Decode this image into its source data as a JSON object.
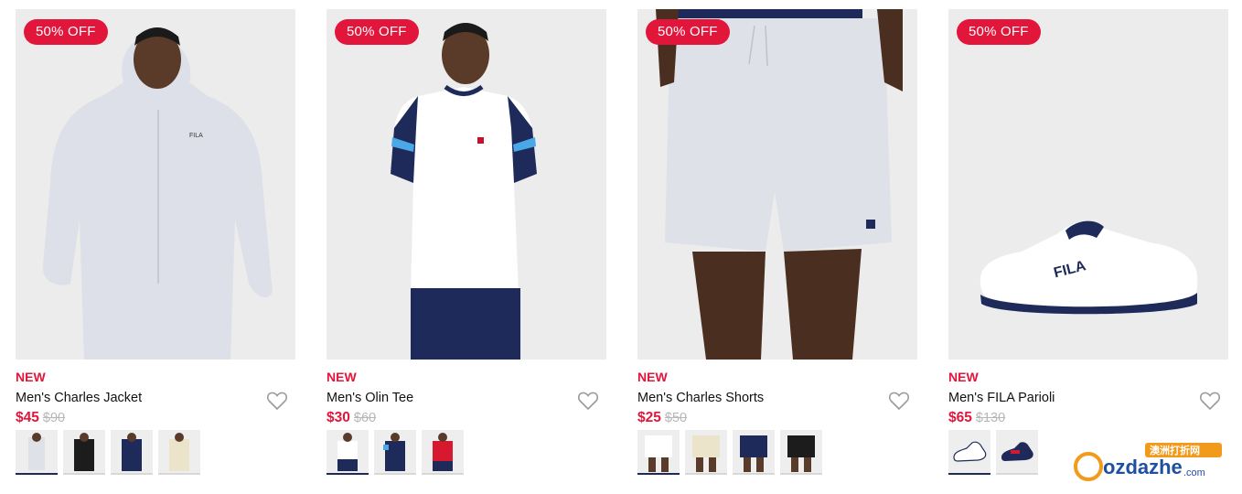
{
  "products": [
    {
      "badge": "50% OFF",
      "tag": "NEW",
      "name": "Men's Charles Jacket",
      "price_now": "$45",
      "price_was": "$90"
    },
    {
      "badge": "50% OFF",
      "tag": "NEW",
      "name": "Men's Olin Tee",
      "price_now": "$30",
      "price_was": "$60"
    },
    {
      "badge": "50% OFF",
      "tag": "NEW",
      "name": "Men's Charles Shorts",
      "price_now": "$25",
      "price_was": "$50"
    },
    {
      "badge": "50% OFF",
      "tag": "NEW",
      "name": "Men's FILA Parioli",
      "price_now": "$65",
      "price_was": "$130"
    }
  ],
  "watermark": {
    "text": "ozdazhe",
    "domain": ".com",
    "chinese": "澳洲打折网"
  },
  "icons": {
    "wishlist": "heart-outline-icon"
  },
  "colors": {
    "accent": "#e2153b",
    "navy": "#1e2a5a",
    "image_bg": "#ececec"
  }
}
